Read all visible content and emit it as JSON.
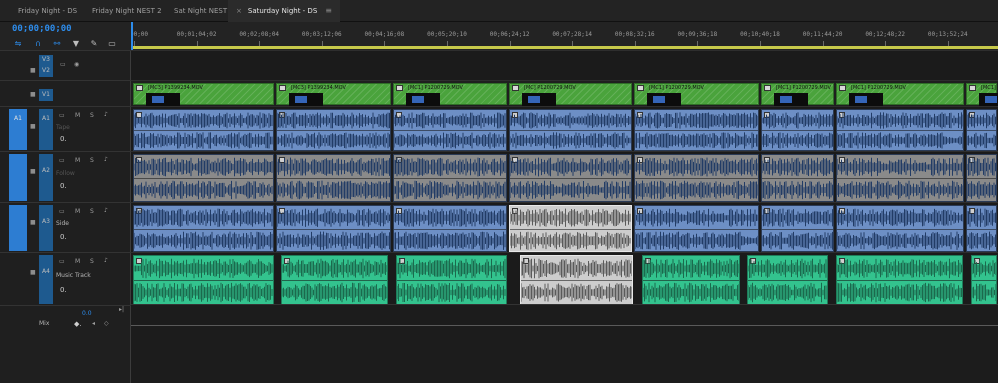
{
  "tabs": [
    {
      "label": "Friday Night - DS",
      "active": false
    },
    {
      "label": "Friday Night NEST 2",
      "active": false
    },
    {
      "label": "Sat Night NEST",
      "active": false
    },
    {
      "label": "Saturday Night - DS",
      "active": true,
      "close": "×",
      "menu": "≡"
    }
  ],
  "timecode": "00;00;00;00",
  "toolbar_icons": [
    "nest-icon",
    "snap-magnet-icon",
    "linked-selection-icon",
    "add-marker-icon",
    "wrench-icon",
    "captions-icon"
  ],
  "ruler": {
    "ticks": [
      "00;00",
      "00;01;04;02",
      "00;02;08;04",
      "00;03;12;06",
      "00;04;16;08",
      "00;05;20;10",
      "00;06;24;12",
      "00;07;28;14",
      "00;08;32;16",
      "00;09;36;18",
      "00;10;40;18",
      "00;11;44;20",
      "00;12;48;22",
      "00;13;52;24"
    ]
  },
  "video_tracks": [
    {
      "id": "V3",
      "lock": "🔒",
      "eye": true
    },
    {
      "id": "V2",
      "lock": "🔒",
      "eye": true
    },
    {
      "id": "V1",
      "lock": "🔒",
      "eye": false
    }
  ],
  "audio_tracks": [
    {
      "src": "A1",
      "id": "A1",
      "name": "Tape",
      "controls": [
        "M",
        "S"
      ],
      "vol": "0."
    },
    {
      "src": "",
      "id": "A2",
      "name": "Follow",
      "controls": [
        "M",
        "S"
      ],
      "vol": "0."
    },
    {
      "src": "",
      "id": "A3",
      "name": "Side",
      "controls": [
        "M",
        "S"
      ],
      "vol": "0."
    },
    {
      "src": "",
      "id": "A4",
      "name": "Music Track",
      "controls": [
        "M",
        "S"
      ],
      "vol": "0."
    }
  ],
  "mix": {
    "label": "Mix",
    "value": "0.0"
  },
  "video_clips": [
    {
      "title": "[MC3] P1399234.MOV"
    },
    {
      "title": "[MC3] P1399234.MOV"
    },
    {
      "title": "[MC1] P1200729.MOV"
    },
    {
      "title": "[MC] P1200729.MOV"
    },
    {
      "title": "[MC1] P1200729.MOV"
    },
    {
      "title": "[MC1] P1200729.MOV"
    },
    {
      "title": "[MC1] P1200729.MOV"
    },
    {
      "title": "[MC1]"
    }
  ],
  "colors": {
    "accent": "#2d8ceb",
    "video_clip": "#4aa33c",
    "audio_clip": "#6d8fc5",
    "music_clip": "#33c38e",
    "selected_clip": "#cdcdcd"
  }
}
